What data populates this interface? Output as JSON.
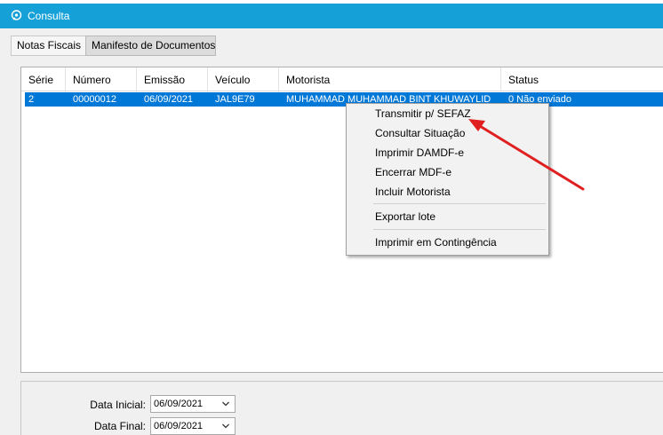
{
  "window": {
    "title": "Consulta",
    "title_bar_color": "#15a1d8"
  },
  "tabs": [
    {
      "label": "Notas Fiscais"
    },
    {
      "label": "Manifesto de Documentos"
    }
  ],
  "grid": {
    "columns": [
      "Série",
      "Número",
      "Emissão",
      "Veículo",
      "Motorista",
      "Status"
    ],
    "rows": [
      {
        "serie": "2",
        "numero": "00000012",
        "emissao": "06/09/2021",
        "veiculo": "JAL9E79",
        "motorista": "MUHAMMAD MUHAMMAD BINT KHUWAYLID",
        "status": "0 Não enviado"
      }
    ],
    "selection_color": "#0078d7"
  },
  "filters": {
    "data_inicial_label": "Data Inicial:",
    "data_inicial_value": "06/09/2021",
    "data_final_label": "Data Final:",
    "data_final_value": "06/09/2021"
  },
  "context_menu": {
    "items": [
      {
        "label": "Transmitir p/ SEFAZ"
      },
      {
        "label": "Consultar Situação"
      },
      {
        "label": "Imprimir DAMDF-e"
      },
      {
        "label": "Encerrar MDF-e"
      },
      {
        "label": "Incluir Motorista"
      },
      {
        "label": "Exportar lote"
      },
      {
        "label": "Imprimir em Contingência"
      }
    ]
  },
  "annotation": {
    "color": "#e02020"
  }
}
